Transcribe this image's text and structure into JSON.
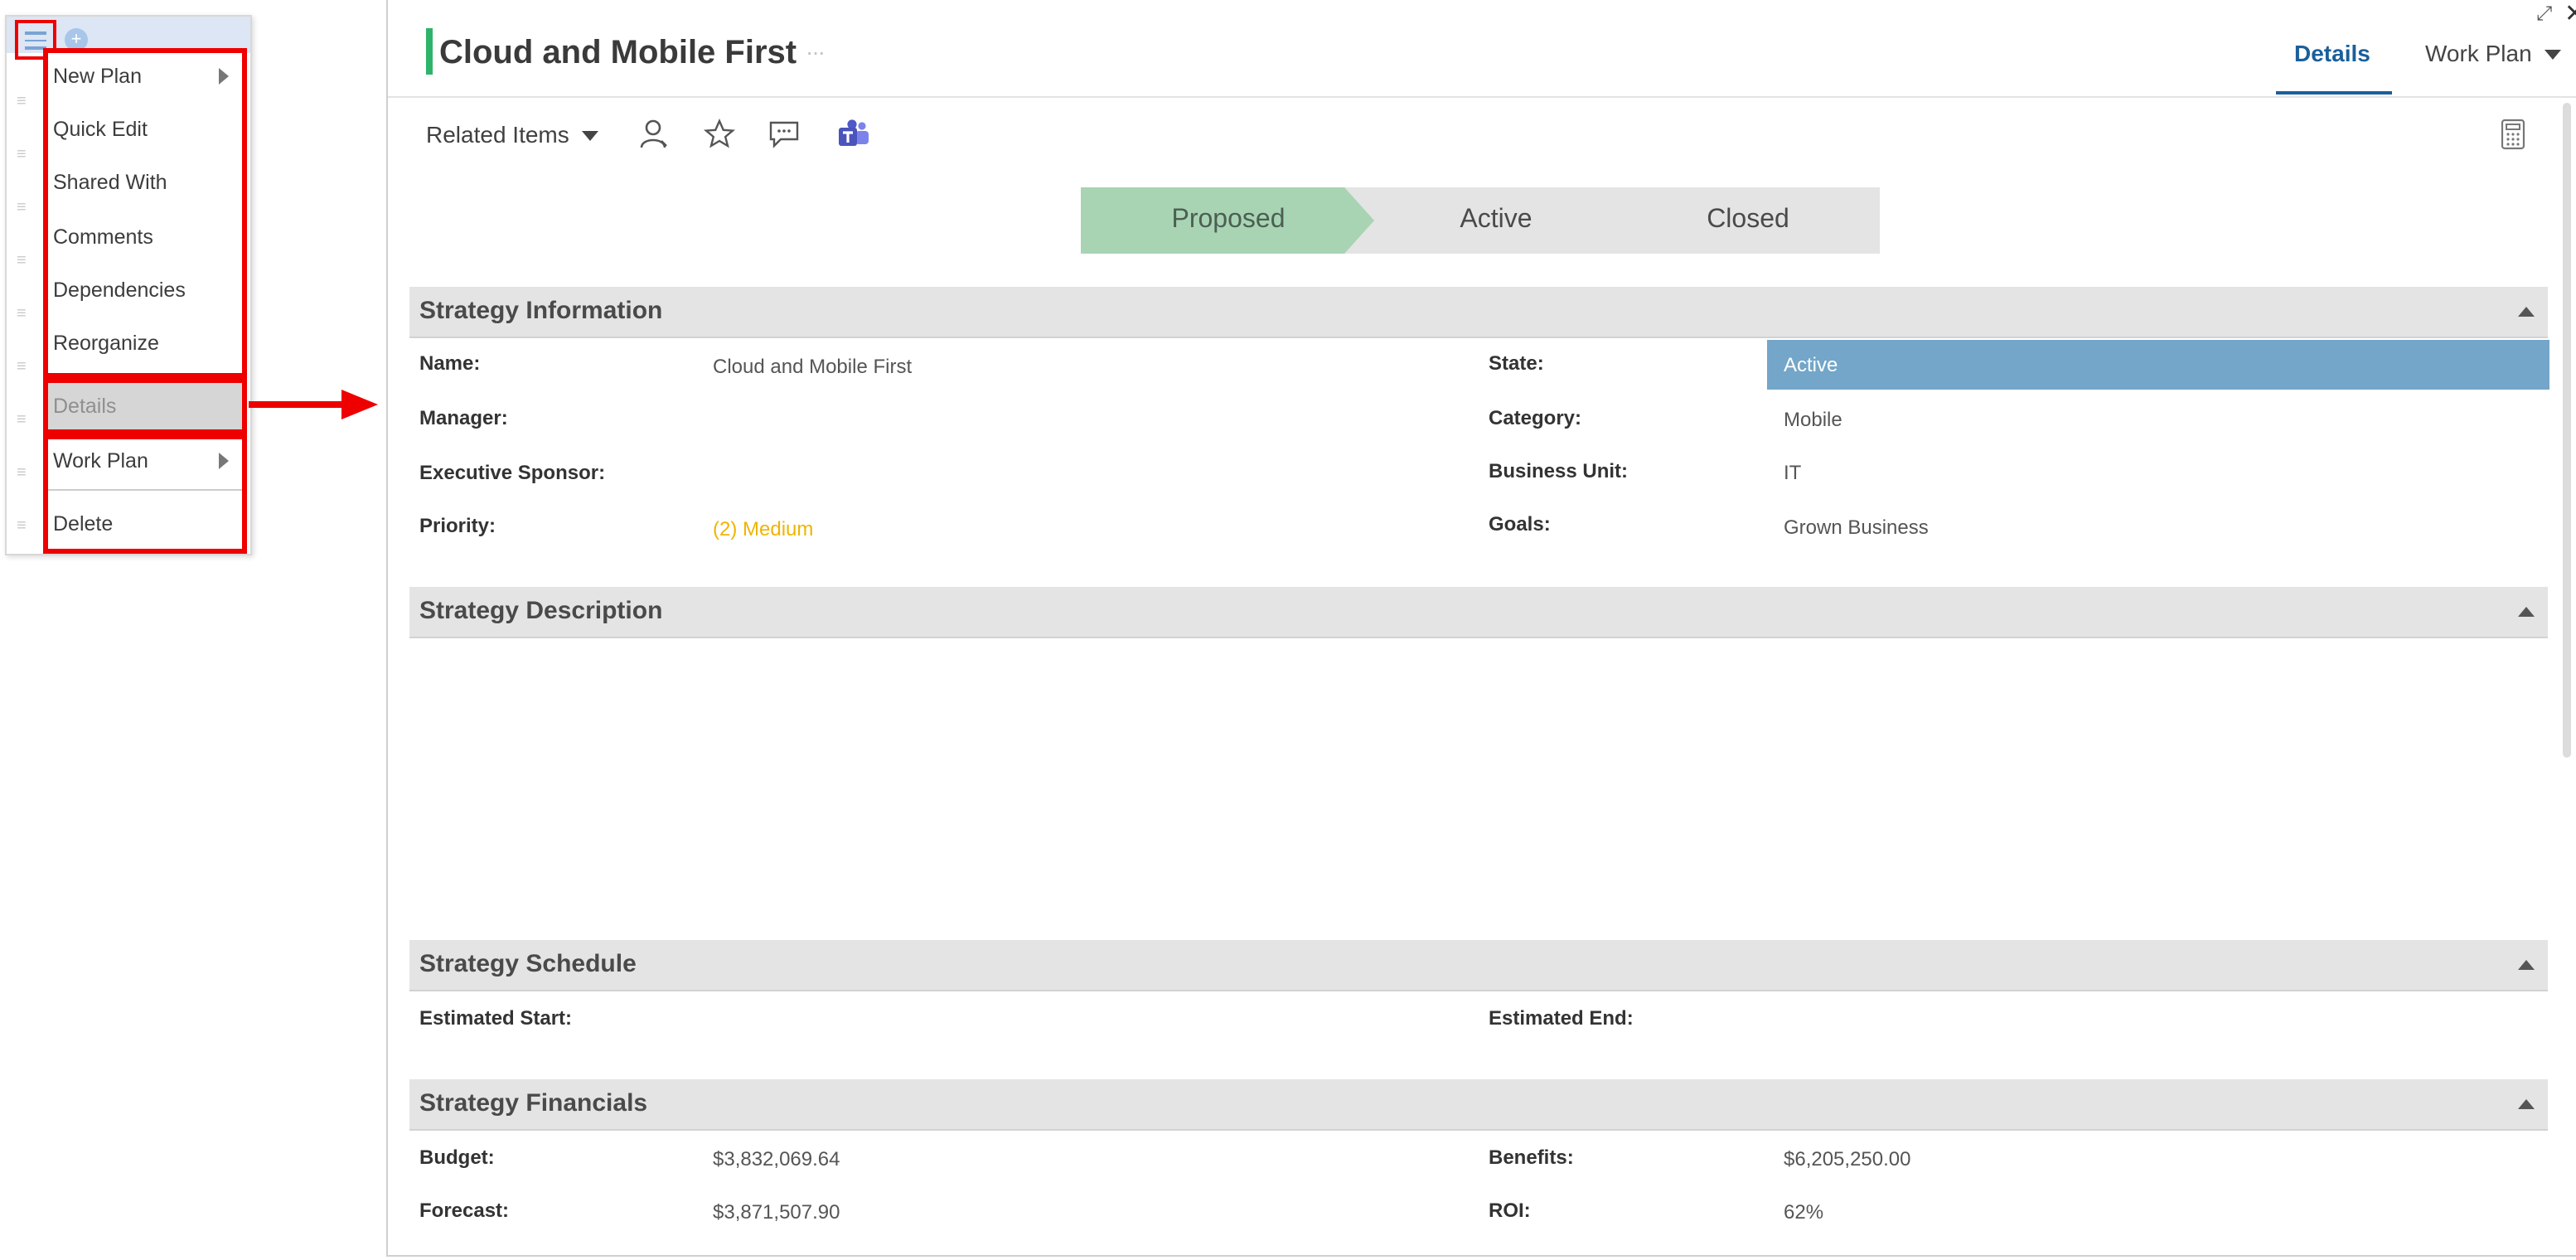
{
  "context_menu": {
    "items": [
      {
        "label": "New Plan",
        "has_submenu": true
      },
      {
        "label": "Quick Edit",
        "has_submenu": false
      },
      {
        "label": "Shared With",
        "has_submenu": false
      },
      {
        "label": "Comments",
        "has_submenu": false
      },
      {
        "label": "Dependencies",
        "has_submenu": false
      },
      {
        "label": "Reorganize",
        "has_submenu": false
      },
      {
        "label": "Details",
        "has_submenu": false,
        "disabled": true
      },
      {
        "label": "Work Plan",
        "has_submenu": true
      },
      {
        "label": "Delete",
        "has_submenu": false
      }
    ]
  },
  "header": {
    "title": "Cloud and Mobile First",
    "more": "···",
    "tabs": [
      {
        "label": "Details",
        "active": true
      },
      {
        "label": "Work Plan",
        "active": false
      }
    ]
  },
  "toolbar": {
    "related_items": "Related Items",
    "icons": [
      "person-icon",
      "star-icon",
      "comment-icon",
      "teams-icon",
      "calculator-icon"
    ]
  },
  "stages": [
    {
      "label": "Proposed",
      "current": true
    },
    {
      "label": "Active",
      "current": false
    },
    {
      "label": "Closed",
      "current": false
    }
  ],
  "sections": {
    "information": {
      "title": "Strategy Information",
      "name_label": "Name:",
      "name_value": "Cloud and Mobile First",
      "manager_label": "Manager:",
      "sponsor_label": "Executive Sponsor:",
      "priority_label": "Priority:",
      "priority_value": "(2) Medium",
      "state_label": "State:",
      "state_value": "Active",
      "category_label": "Category:",
      "category_value": "Mobile",
      "business_unit_label": "Business Unit:",
      "business_unit_value": "IT",
      "goals_label": "Goals:",
      "goals_value": "Grown Business"
    },
    "description": {
      "title": "Strategy Description"
    },
    "schedule": {
      "title": "Strategy Schedule",
      "start_label": "Estimated Start:",
      "end_label": "Estimated End:"
    },
    "financials": {
      "title": "Strategy Financials",
      "budget_label": "Budget:",
      "budget_value": "$3,832,069.64",
      "forecast_label": "Forecast:",
      "forecast_value": "$3,871,507.90",
      "benefits_label": "Benefits:",
      "benefits_value": "$6,205,250.00",
      "roi_label": "ROI:",
      "roi_value": "62%"
    }
  },
  "colors": {
    "accent": "#1a5f9b",
    "title_bar": "#2db46a",
    "stage_current": "#a8d4b4",
    "state_highlight": "#73a6c9",
    "priority": "#f0b400",
    "annotation": "#ee0000"
  }
}
